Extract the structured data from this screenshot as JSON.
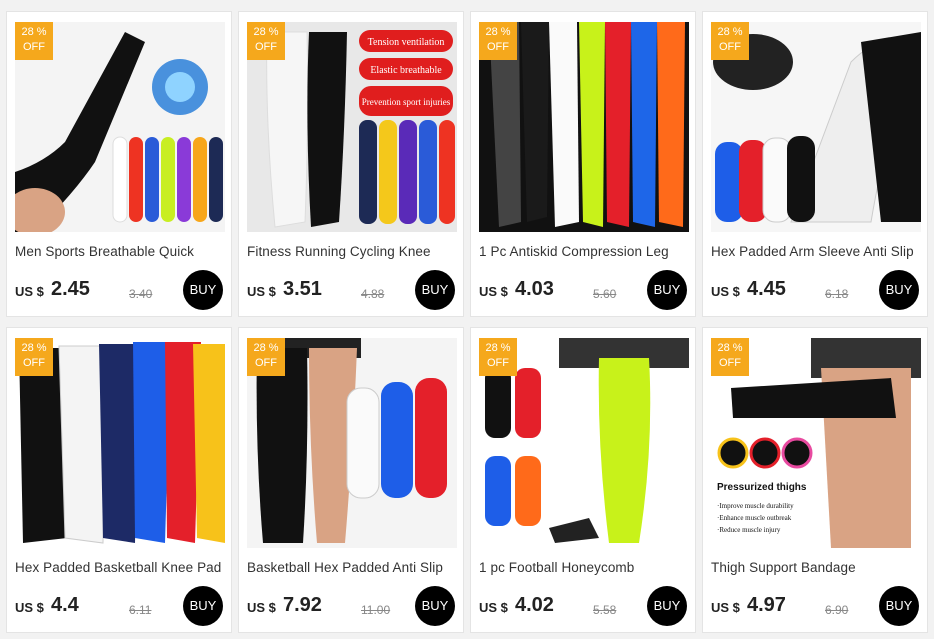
{
  "accent_color": "#f5a81c",
  "buy_button_color": "#000000",
  "products": [
    {
      "badge_top": "28 %",
      "badge_bottom": "OFF",
      "title": "Men Sports Breathable Quick",
      "currency": "US $",
      "price": "2.45",
      "old_price": "3.40",
      "buy_label": "BUY"
    },
    {
      "badge_top": "28 %",
      "badge_bottom": "OFF",
      "title": "Fitness Running Cycling Knee",
      "currency": "US $",
      "price": "3.51",
      "old_price": "4.88",
      "buy_label": "BUY",
      "image_text": [
        "Tension ventilation",
        "Elastic breathable",
        "Prevention sport injuries"
      ]
    },
    {
      "badge_top": "28 %",
      "badge_bottom": "OFF",
      "title": "1 Pc Antiskid Compression Leg",
      "currency": "US $",
      "price": "4.03",
      "old_price": "5.60",
      "buy_label": "BUY"
    },
    {
      "badge_top": "28 %",
      "badge_bottom": "OFF",
      "title": "Hex Padded Arm Sleeve Anti Slip",
      "currency": "US $",
      "price": "4.45",
      "old_price": "6.18",
      "buy_label": "BUY"
    },
    {
      "badge_top": "28 %",
      "badge_bottom": "OFF",
      "title": "Hex Padded Basketball Knee Pad",
      "currency": "US $",
      "price": "4.4",
      "old_price": "6.11",
      "buy_label": "BUY"
    },
    {
      "badge_top": "28 %",
      "badge_bottom": "OFF",
      "title": "Basketball Hex Padded Anti Slip",
      "currency": "US $",
      "price": "7.92",
      "old_price": "11.00",
      "buy_label": "BUY"
    },
    {
      "badge_top": "28 %",
      "badge_bottom": "OFF",
      "title": "1 pc Football Honeycomb",
      "currency": "US $",
      "price": "4.02",
      "old_price": "5.58",
      "buy_label": "BUY"
    },
    {
      "badge_top": "28 %",
      "badge_bottom": "OFF",
      "title": "Thigh Support Bandage",
      "currency": "US $",
      "price": "4.97",
      "old_price": "6.90",
      "buy_label": "BUY",
      "image_text": [
        "Pressurized thighs",
        "·Improve muscle durability",
        "·Enhance muscle outbreak",
        "·Reduce muscle injury"
      ]
    }
  ]
}
